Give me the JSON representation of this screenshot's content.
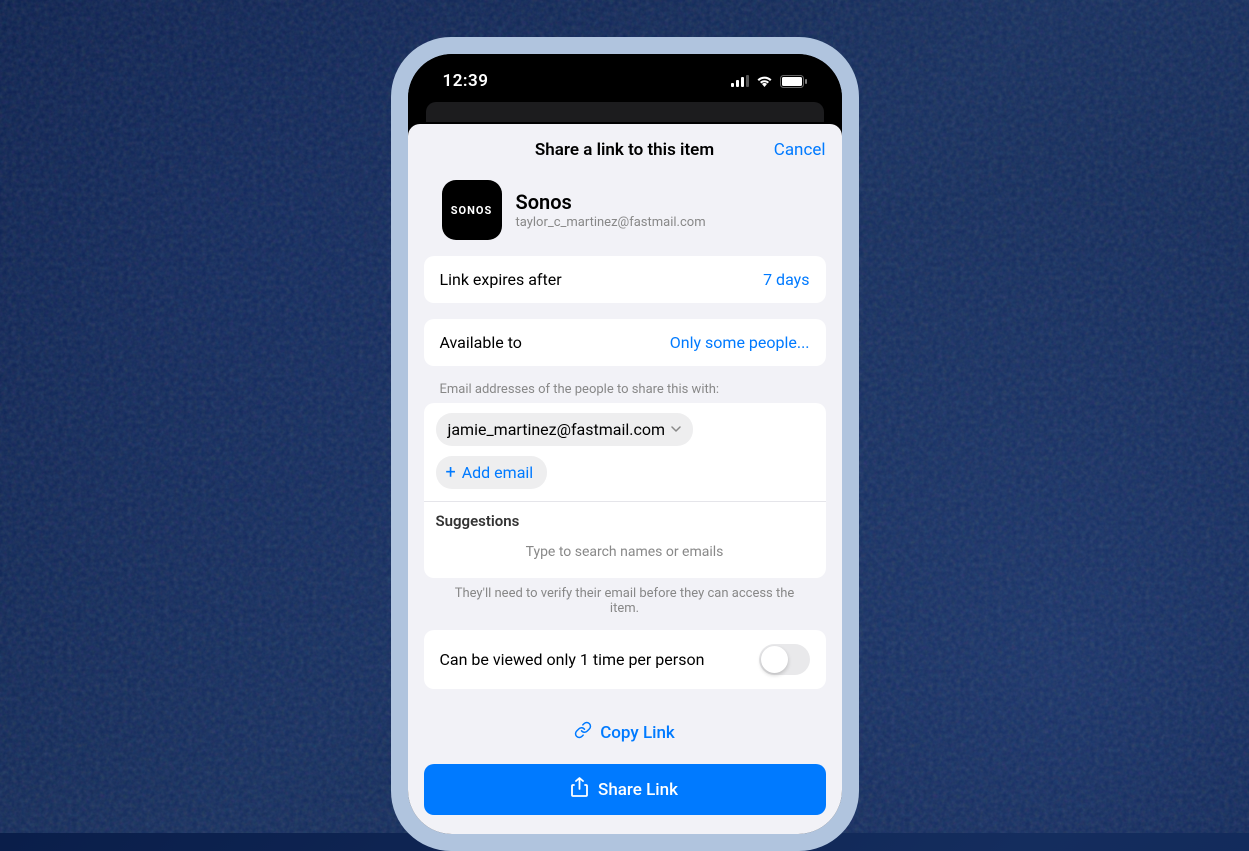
{
  "status_bar": {
    "time": "12:39"
  },
  "modal": {
    "title": "Share a link to this item",
    "cancel_label": "Cancel"
  },
  "item": {
    "icon_text": "SONOS",
    "name": "Sonos",
    "email": "taylor_c_martinez@fastmail.com"
  },
  "expiry": {
    "label": "Link expires after",
    "value": "7 days"
  },
  "availability": {
    "label": "Available to",
    "value": "Only some people..."
  },
  "emails": {
    "section_header": "Email addresses of the people to share this with:",
    "chips": [
      "jamie_martinez@fastmail.com"
    ],
    "add_label": "Add email",
    "suggestions_label": "Suggestions",
    "suggestions_placeholder": "Type to search names or emails",
    "helper_text": "They'll need to verify their email before they can access the item."
  },
  "view_once": {
    "label": "Can be viewed only 1 time per person",
    "enabled": false
  },
  "actions": {
    "copy_link": "Copy Link",
    "share_link": "Share Link"
  }
}
